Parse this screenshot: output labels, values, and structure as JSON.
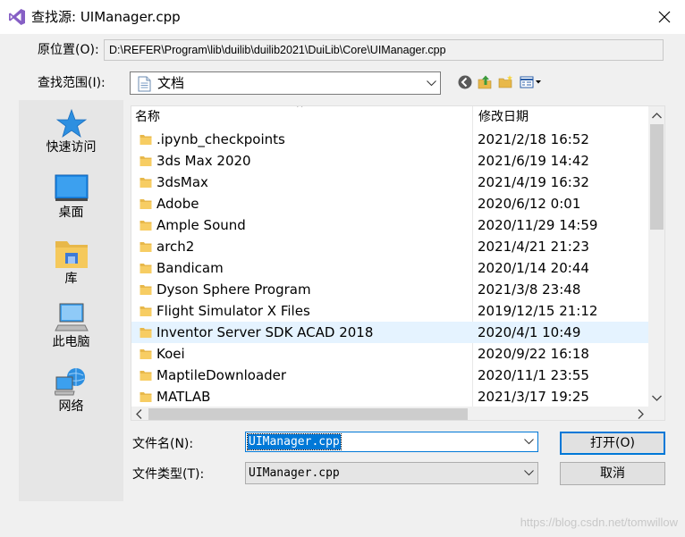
{
  "window": {
    "title": "查找源: UIManager.cpp",
    "close_icon": "close-icon"
  },
  "location": {
    "label": "原位置(O):",
    "path": "D:\\REFER\\Program\\lib\\duilib\\duilib2021\\DuiLib\\Core\\UIManager.cpp"
  },
  "look_in": {
    "label": "查找范围(I):",
    "value": "文档",
    "icon": "documents-icon"
  },
  "toolbar": {
    "back_icon": "back-icon",
    "up_icon": "up-folder-icon",
    "new_folder_icon": "new-folder-icon",
    "view_icon": "view-menu-icon"
  },
  "places": [
    {
      "label": "快速访问",
      "icon": "star-icon"
    },
    {
      "label": "桌面",
      "icon": "desktop-icon"
    },
    {
      "label": "库",
      "icon": "library-icon"
    },
    {
      "label": "此电脑",
      "icon": "computer-icon"
    },
    {
      "label": "网络",
      "icon": "network-icon"
    }
  ],
  "file_list": {
    "columns": {
      "name": "名称",
      "date": "修改日期"
    },
    "sort_indicator": "^",
    "rows": [
      {
        "name": ".ipynb_checkpoints",
        "date": "2021/2/18 16:52"
      },
      {
        "name": "3ds Max 2020",
        "date": "2021/6/19 14:42"
      },
      {
        "name": "3dsMax",
        "date": "2021/4/19 16:32"
      },
      {
        "name": "Adobe",
        "date": "2020/6/12 0:01"
      },
      {
        "name": "Ample Sound",
        "date": "2020/11/29 14:59"
      },
      {
        "name": "arch2",
        "date": "2021/4/21 21:23"
      },
      {
        "name": "Bandicam",
        "date": "2020/1/14 20:44"
      },
      {
        "name": "Dyson Sphere Program",
        "date": "2021/3/8 23:48"
      },
      {
        "name": "Flight Simulator X Files",
        "date": "2019/12/15 21:12"
      },
      {
        "name": "Inventor Server SDK ACAD 2018",
        "date": "2020/4/1 10:49",
        "selected": true
      },
      {
        "name": "Koei",
        "date": "2020/9/22 16:18"
      },
      {
        "name": "MaptileDownloader",
        "date": "2020/11/1 23:55"
      },
      {
        "name": "MATLAB",
        "date": "2021/3/17 19:25"
      }
    ]
  },
  "file_name": {
    "label": "文件名(N):",
    "value": "UIManager.cpp"
  },
  "file_type": {
    "label": "文件类型(T):",
    "value": "UIManager.cpp"
  },
  "buttons": {
    "open": "打开(O)",
    "cancel": "取消"
  },
  "watermark": "https://blog.csdn.net/tomwillow",
  "colors": {
    "accent": "#0078d7",
    "selected_row": "#e5f3ff",
    "folder": "#e8b84a"
  }
}
